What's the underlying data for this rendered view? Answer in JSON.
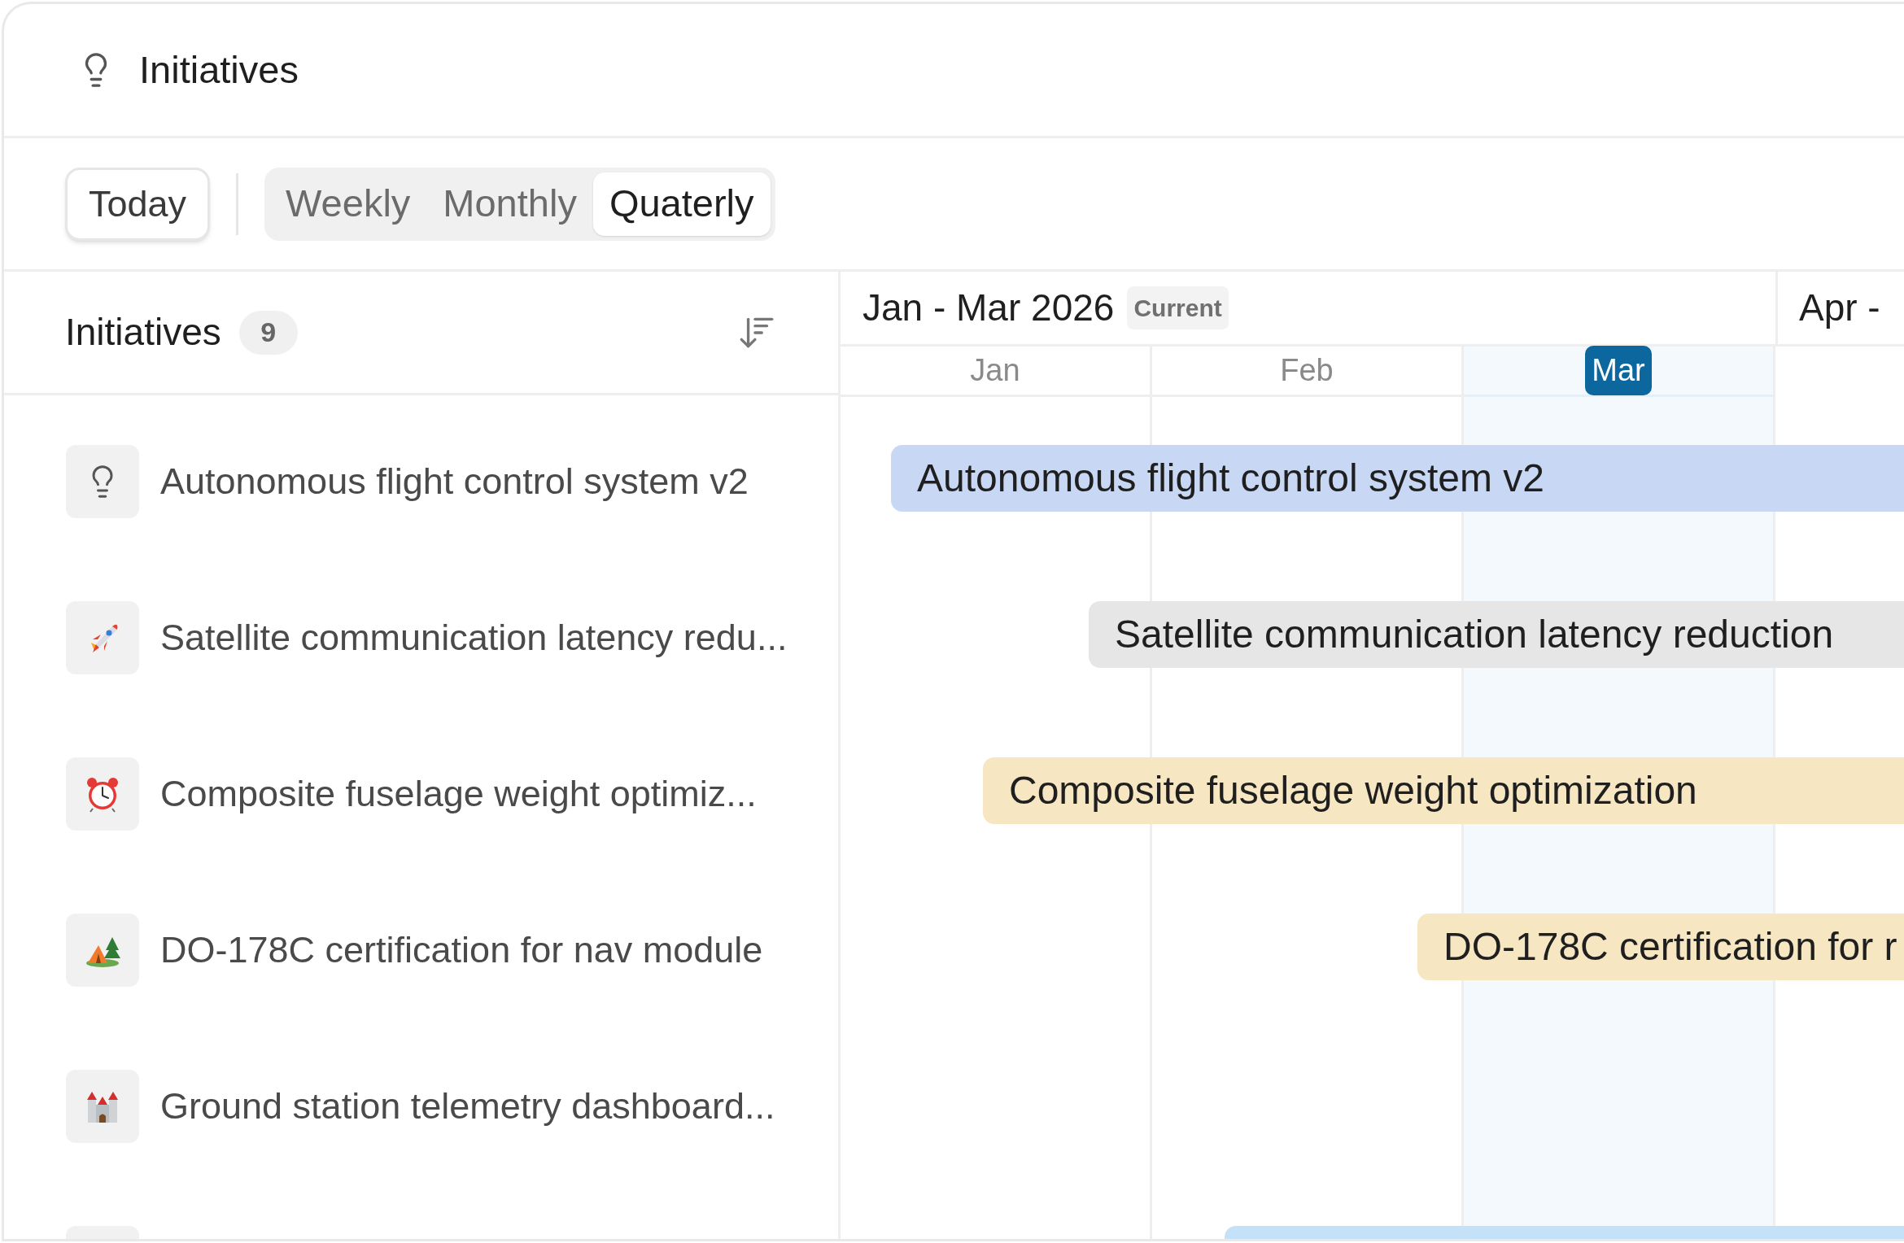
{
  "header": {
    "title": "Initiatives"
  },
  "toolbar": {
    "today": "Today",
    "views": [
      {
        "label": "Weekly",
        "selected": false
      },
      {
        "label": "Monthly",
        "selected": false
      },
      {
        "label": "Quaterly",
        "selected": true
      }
    ]
  },
  "list": {
    "title": "Initiatives",
    "count": "9",
    "items": [
      {
        "kind": "bulb",
        "name": "Autonomous flight control system v2",
        "bar": {
          "label": "Autonomous flight control system v2",
          "color": "#c8d8f4"
        }
      },
      {
        "kind": "rocket",
        "name": "Satellite communication latency redu...",
        "bar": {
          "label": "Satellite communication latency reduction",
          "color": "#e6e6e6"
        }
      },
      {
        "kind": "clock",
        "name": "Composite fuselage weight optimiz...",
        "bar": {
          "label": "Composite fuselage weight optimization",
          "color": "#f6e6c2"
        }
      },
      {
        "kind": "tent",
        "name": "DO-178C certification for nav module",
        "bar": {
          "label": "DO-178C certification for r",
          "color": "#f6e6c2"
        }
      },
      {
        "kind": "castle",
        "name": "Ground station telemetry dashboard..."
      },
      {
        "kind": "hidden",
        "bar": {
          "color": "#c5e1f7"
        }
      }
    ]
  },
  "timeline": {
    "quarters": [
      {
        "label": "Jan - Mar 2026",
        "badge": "Current"
      },
      {
        "label": "Apr -"
      }
    ],
    "months": [
      {
        "label": "Jan",
        "selected": false
      },
      {
        "label": "Feb",
        "selected": false
      },
      {
        "label": "Mar",
        "selected": true
      }
    ]
  }
}
